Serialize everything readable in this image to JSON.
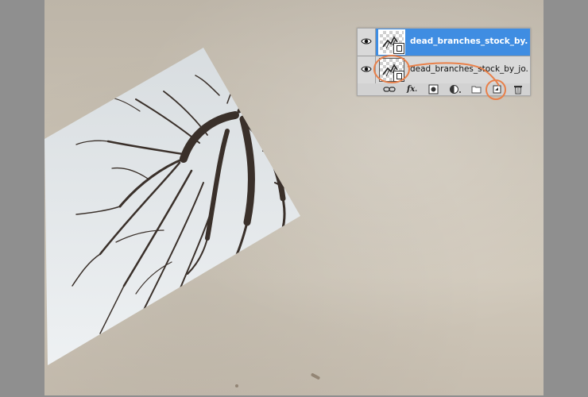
{
  "app": {
    "name": "Photoshop layers panel"
  },
  "layers": [
    {
      "name": "dead_branches_stock_by...",
      "selected": true,
      "visible": true,
      "icon": "smart-object-thumbnail"
    },
    {
      "name": "dead_branches_stock_by_jo...",
      "selected": false,
      "visible": true,
      "icon": "smart-object-thumbnail"
    }
  ],
  "toolbar": {
    "link_icon": "link-icon",
    "fx_label": "fx",
    "mask_icon": "layer-mask-icon",
    "adjustment_icon": "adjustment-layer-icon",
    "group_icon": "folder-icon",
    "new_layer_icon": "new-layer-icon",
    "delete_icon": "trash-icon"
  },
  "annotations": {
    "color": "#e8804a"
  },
  "colors": {
    "selected_row": "#3f8de2",
    "panel_bg": "#d9d9d9",
    "canvas_paper": "#c9c1b3"
  }
}
